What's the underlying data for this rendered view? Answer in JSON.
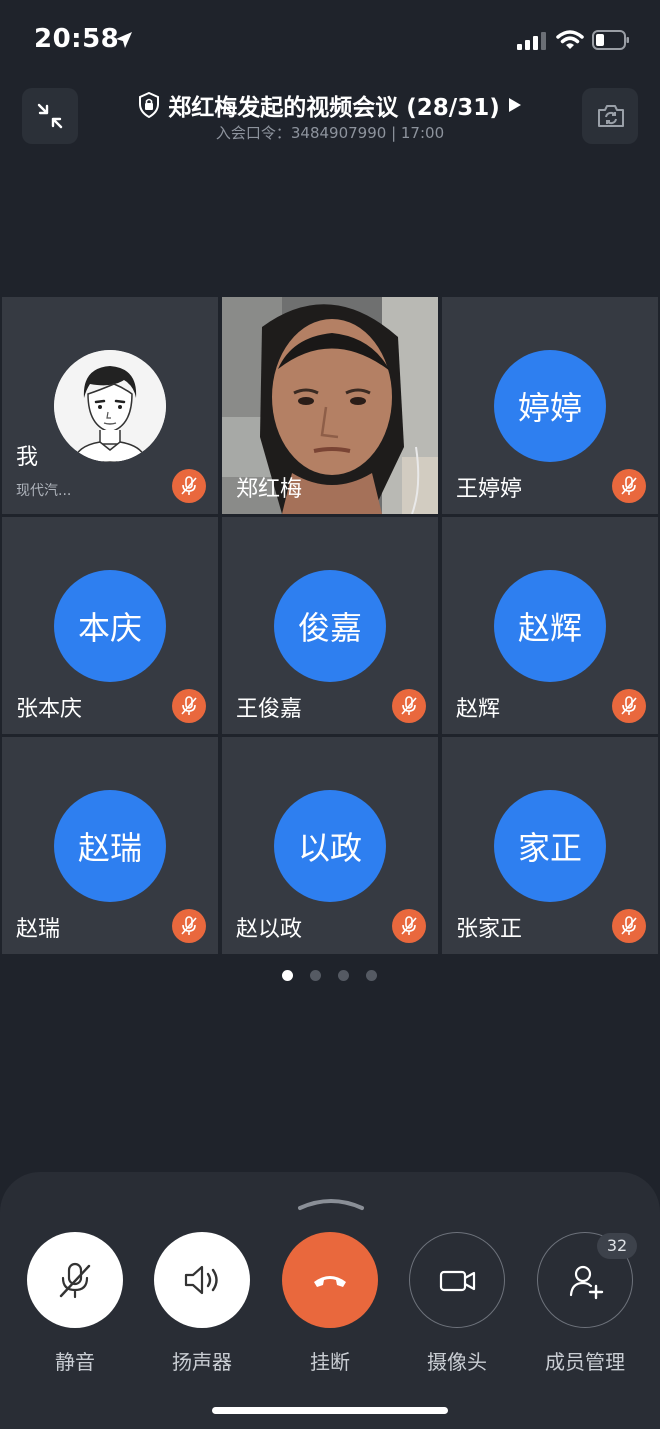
{
  "status_bar": {
    "time": "20:58"
  },
  "header": {
    "title": "郑红梅发起的视频会议 (28/31)",
    "subtitle": "入会口令：3484907990 | 17:00"
  },
  "participants": [
    {
      "name": "我",
      "org": "现代汽...",
      "kind": "me",
      "muted": true
    },
    {
      "name": "郑红梅",
      "kind": "video",
      "muted": false
    },
    {
      "name": "王婷婷",
      "initials": "婷婷",
      "muted": true
    },
    {
      "name": "张本庆",
      "initials": "本庆",
      "muted": true
    },
    {
      "name": "王俊嘉",
      "initials": "俊嘉",
      "muted": true
    },
    {
      "name": "赵辉",
      "initials": "赵辉",
      "muted": true
    },
    {
      "name": "赵瑞",
      "initials": "赵瑞",
      "muted": true
    },
    {
      "name": "赵以政",
      "initials": "以政",
      "muted": true
    },
    {
      "name": "张家正",
      "initials": "家正",
      "muted": true
    }
  ],
  "pager": {
    "pages": 4,
    "current": 1
  },
  "controls": {
    "mute_label": "静音",
    "speaker_label": "扬声器",
    "hangup_label": "挂断",
    "camera_label": "摄像头",
    "members_label": "成员管理",
    "members_count": "32"
  },
  "colors": {
    "accent": "#2e7ff0",
    "mute": "#e9683d",
    "background": "#1f232b"
  }
}
